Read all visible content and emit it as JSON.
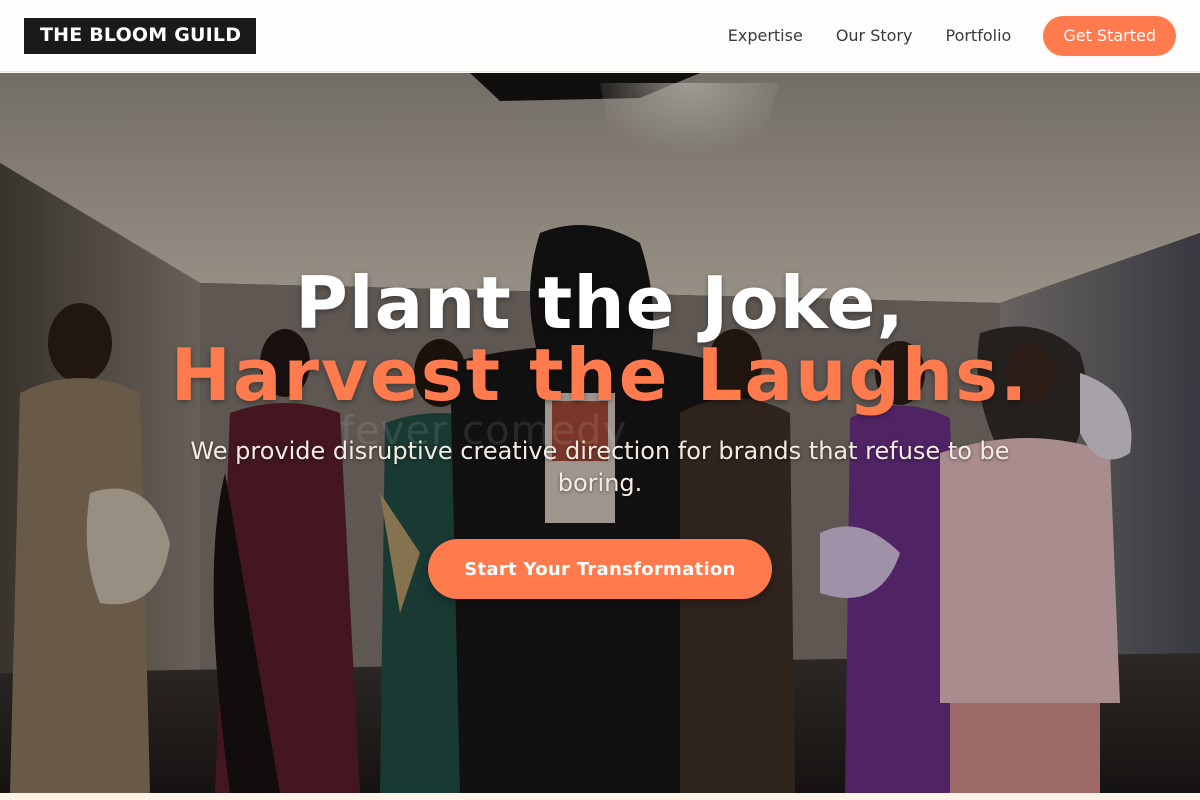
{
  "nav": {
    "logo": "THE BLOOM GUILD",
    "links": [
      {
        "label": "Expertise"
      },
      {
        "label": "Our Story"
      },
      {
        "label": "Portfolio"
      }
    ],
    "cta_label": "Get Started"
  },
  "hero": {
    "headline_line1": "Plant the Joke,",
    "headline_line2": "Harvest the Laughs.",
    "subheadline": "We provide disruptive creative direction for brands that refuse to be boring.",
    "cta_label": "Start Your Transformation",
    "background_image": "photo of a group of fashion-styled people posing in a studio",
    "watermark": "fever comedy"
  },
  "colors": {
    "accent": "#ff7a4d",
    "logo_bg": "#1c1a19",
    "nav_bg": "#fffdfb",
    "page_bg": "#fdf8f2"
  }
}
